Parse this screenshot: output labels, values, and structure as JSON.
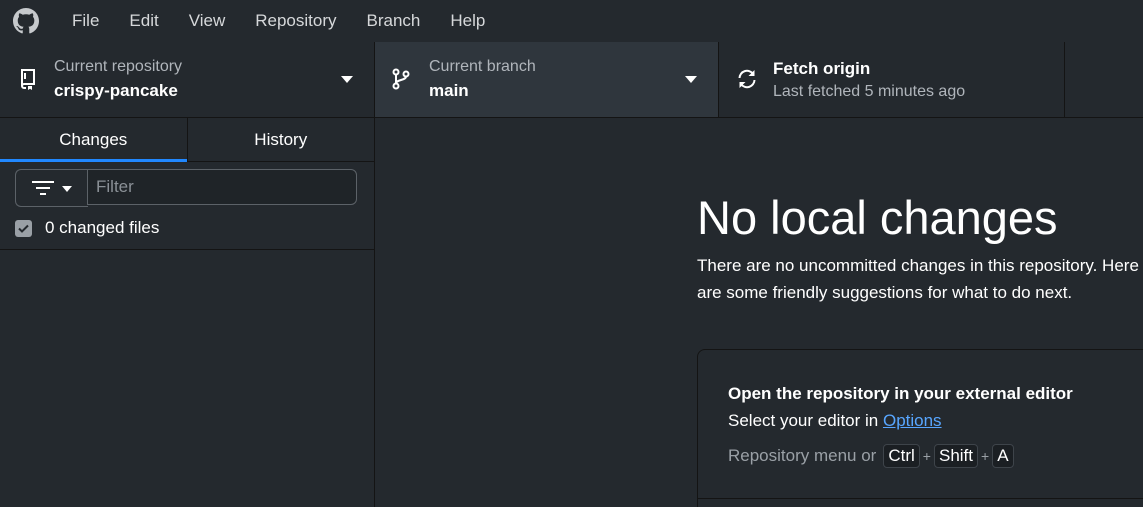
{
  "menu": [
    "File",
    "Edit",
    "View",
    "Repository",
    "Branch",
    "Help"
  ],
  "toolbar": {
    "repo": {
      "label": "Current repository",
      "value": "crispy-pancake"
    },
    "branch": {
      "label": "Current branch",
      "value": "main"
    },
    "fetch": {
      "label": "Fetch origin",
      "value": "Last fetched 5 minutes ago"
    }
  },
  "sidebar": {
    "tabs": [
      "Changes",
      "History"
    ],
    "filter_placeholder": "Filter",
    "changed_files": "0 changed files"
  },
  "main": {
    "title": "No local changes",
    "description": "There are no uncommitted changes in this repository. Here are some friendly suggestions for what to do next.",
    "card": {
      "title": "Open the repository in your external editor",
      "desc_prefix": "Select your editor in ",
      "desc_link": "Options",
      "shortcut_prefix": "Repository menu or",
      "keys": [
        "Ctrl",
        "Shift",
        "A"
      ],
      "plus": "+"
    }
  },
  "colors": {
    "accent": "#2188ff",
    "link": "#58a6ff",
    "background": "#24292e"
  }
}
